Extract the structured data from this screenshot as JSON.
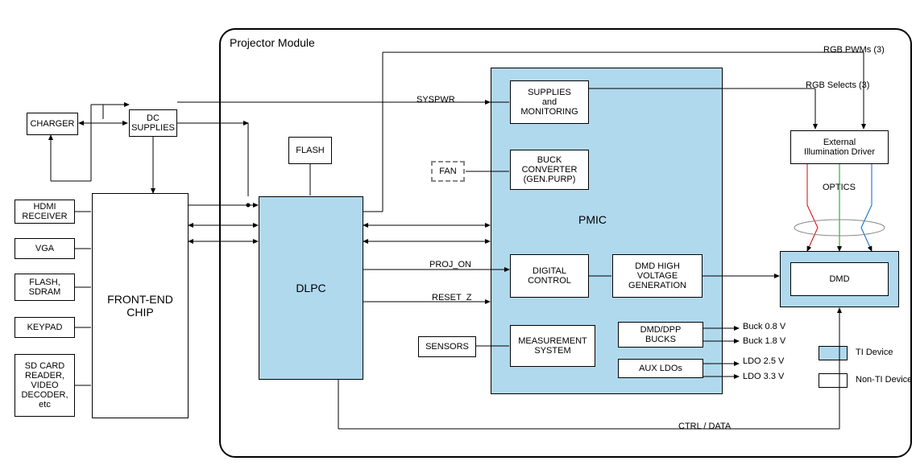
{
  "module_title": "Projector Module",
  "left": {
    "charger": "CHARGER",
    "dc_supplies": "DC\nSUPPLIES",
    "hdmi": "HDMI\nRECEIVER",
    "vga": "VGA",
    "flash_sdram": "FLASH,\nSDRAM",
    "keypad": "KEYPAD",
    "sd_card": "SD CARD\nREADER,\nVIDEO\nDECODER,\netc"
  },
  "front_end": "FRONT-END\nCHIP",
  "flash": "FLASH",
  "dlpc": "DLPC",
  "fan": "FAN",
  "sensors": "SENSORS",
  "pmic": {
    "title": "PMIC",
    "supplies": "SUPPLIES\nand\nMONITORING",
    "buck_conv": "BUCK\nCONVERTER\n(GEN.PURP)",
    "digital": "DIGITAL\nCONTROL",
    "dmd_hv": "DMD HIGH\nVOLTAGE\nGENERATION",
    "measurement": "MEASUREMENT\nSYSTEM",
    "dmd_bucks": "DMD/DPP\nBUCKS",
    "aux_ldos": "AUX LDOs"
  },
  "signals": {
    "syspwr": "SYSPWR",
    "proj_on": "PROJ_ON",
    "reset_z": "RESET_Z",
    "ctrl_data": "CTRL / DATA",
    "rgb_pwms": "RGB PWMs (3)",
    "rgb_selects": "RGB Selects (3)",
    "buck08": "Buck 0.8 V",
    "buck18": "Buck 1.8 V",
    "ldo25": "LDO 2.5 V",
    "ldo33": "LDO 3.3 V"
  },
  "right": {
    "ext_illum": "External\nIllumination Driver",
    "optics": "OPTICS",
    "dmd": "DMD"
  },
  "legend": {
    "ti": "TI Device",
    "nonti": "Non-TI Device"
  }
}
